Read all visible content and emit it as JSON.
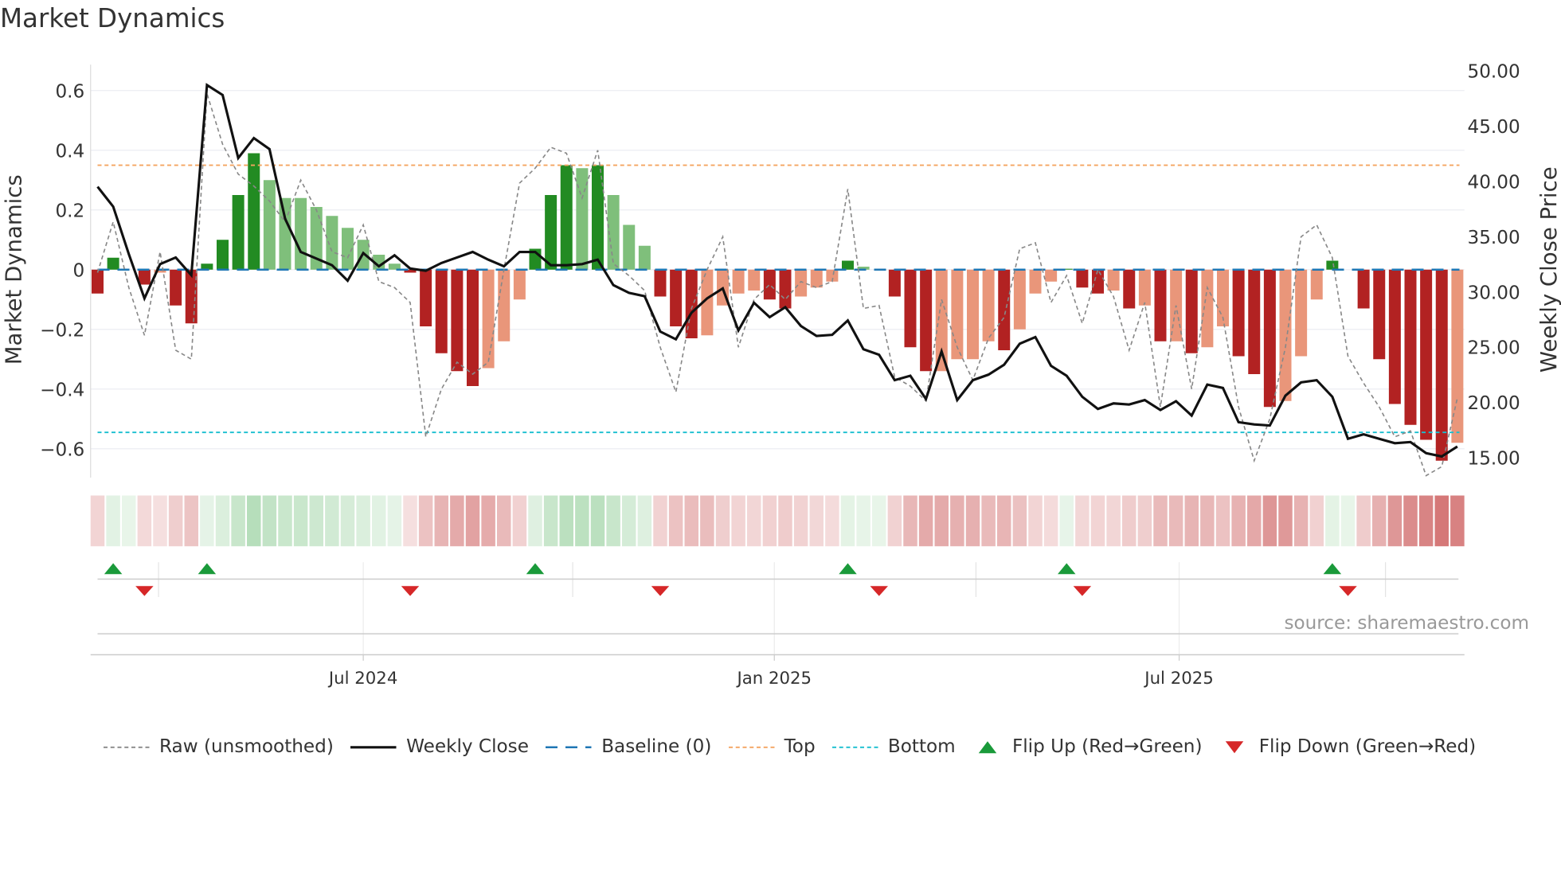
{
  "title": "Market Dynamics",
  "source": "source: sharemaestro.com",
  "colors": {
    "strong_green": "#228b22",
    "weak_green": "#7fbf7b",
    "strong_red": "#b22222",
    "weak_red": "#e9967a",
    "baseline": "#1f77b4",
    "top": "#f4a460",
    "bottom": "#17becf",
    "weekly_close": "#111111",
    "raw": "#888888",
    "flip_up": "#1a9a3a",
    "flip_down": "#d62728"
  },
  "legend": [
    {
      "key": "raw",
      "label": "Raw (unsmoothed)"
    },
    {
      "key": "close",
      "label": "Weekly Close"
    },
    {
      "key": "baseline",
      "label": "Baseline (0)"
    },
    {
      "key": "top",
      "label": "Top"
    },
    {
      "key": "bottom",
      "label": "Bottom"
    },
    {
      "key": "flip_up",
      "label": "Flip Up (Red→Green)"
    },
    {
      "key": "flip_down",
      "label": "Flip Down (Green→Red)"
    }
  ],
  "chart_data": {
    "type": "bar",
    "title": "Market Dynamics",
    "ylabel": "Market Dynamics",
    "y2label": "Weekly Close Price",
    "ylim": [
      -0.69,
      0.69
    ],
    "y2lim": [
      12.8,
      52.2
    ],
    "yticks": [
      "0.6",
      "0.4",
      "0.2",
      "0",
      "−0.2",
      "−0.4",
      "−0.6"
    ],
    "ytick_values": [
      0.6,
      0.4,
      0.2,
      0,
      -0.2,
      -0.4,
      -0.6
    ],
    "y2ticks": [
      "50.00",
      "45.00",
      "40.00",
      "35.00",
      "30.00",
      "25.00",
      "20.00",
      "15.00"
    ],
    "y2tick_values": [
      50,
      45,
      40,
      35,
      30,
      25,
      20,
      15
    ],
    "xticks": [
      {
        "label": "Jul 2024",
        "week": 17
      },
      {
        "label": "Jan 2025",
        "week": 43.3
      },
      {
        "label": "Jul 2025",
        "week": 69.2
      }
    ],
    "minor_xticks_week": [
      3.9,
      30.4,
      56.2,
      82.4
    ],
    "top_level": 0.35,
    "bottom_level": -0.545,
    "baseline": 0,
    "grid": true,
    "legend_position": "bottom",
    "bars": {
      "values": [
        -0.08,
        0.04,
        0,
        -0.05,
        -0.01,
        -0.12,
        -0.18,
        0.02,
        0.1,
        0.25,
        0.39,
        0.3,
        0.24,
        0.24,
        0.21,
        0.18,
        0.14,
        0.1,
        0.05,
        0.02,
        -0.01,
        -0.19,
        -0.28,
        -0.34,
        -0.39,
        -0.33,
        -0.24,
        -0.1,
        0.07,
        0.25,
        0.35,
        0.34,
        0.35,
        0.25,
        0.15,
        0.08,
        -0.09,
        -0.19,
        -0.23,
        -0.22,
        -0.12,
        -0.08,
        -0.07,
        -0.1,
        -0.13,
        -0.09,
        -0.06,
        -0.04,
        0.03,
        0.01,
        0,
        -0.09,
        -0.26,
        -0.34,
        -0.34,
        -0.3,
        -0.3,
        -0.24,
        -0.27,
        -0.2,
        -0.08,
        -0.04,
        0.003,
        -0.06,
        -0.08,
        -0.07,
        -0.13,
        -0.12,
        -0.24,
        -0.24,
        -0.28,
        -0.26,
        -0.19,
        -0.29,
        -0.35,
        -0.46,
        -0.44,
        -0.29,
        -0.1,
        0.03,
        0,
        -0.13,
        -0.3,
        -0.45,
        -0.52,
        -0.57,
        -0.64,
        -0.58
      ],
      "strength": [
        "s",
        "s",
        "w",
        "s",
        "w",
        "s",
        "s",
        "s",
        "s",
        "s",
        "s",
        "w",
        "w",
        "w",
        "w",
        "w",
        "w",
        "w",
        "w",
        "w",
        "s",
        "s",
        "s",
        "s",
        "s",
        "w",
        "w",
        "w",
        "s",
        "s",
        "s",
        "w",
        "s",
        "w",
        "w",
        "w",
        "s",
        "s",
        "s",
        "w",
        "w",
        "w",
        "w",
        "s",
        "s",
        "w",
        "w",
        "w",
        "s",
        "w",
        "w",
        "s",
        "s",
        "s",
        "w",
        "w",
        "w",
        "w",
        "s",
        "w",
        "w",
        "w",
        "s",
        "s",
        "s",
        "w",
        "s",
        "w",
        "s",
        "w",
        "s",
        "w",
        "w",
        "s",
        "s",
        "s",
        "w",
        "w",
        "w",
        "s",
        "w",
        "s",
        "s",
        "s",
        "s",
        "s",
        "s",
        "w"
      ]
    },
    "weekly_close": [
      39.5,
      37.7,
      33.4,
      29.4,
      32.5,
      33.1,
      31.5,
      48.7,
      47.8,
      42.1,
      43.9,
      42.9,
      36.6,
      33.6,
      33.0,
      32.4,
      31.0,
      33.5,
      32.3,
      33.3,
      32.1,
      31.9,
      32.6,
      33.1,
      33.6,
      32.9,
      32.3,
      33.6,
      33.6,
      32.4,
      32.4,
      32.5,
      32.9,
      30.6,
      29.9,
      29.6,
      26.4,
      25.7,
      28.1,
      29.4,
      30.3,
      26.5,
      29.0,
      27.7,
      28.6,
      26.9,
      26.0,
      26.1,
      27.4,
      24.8,
      24.3,
      22.0,
      22.4,
      20.3,
      24.6,
      20.2,
      22.0,
      22.5,
      23.4,
      25.3,
      25.9,
      23.3,
      22.4,
      20.5,
      19.4,
      19.9,
      19.8,
      20.2,
      19.3,
      20.1,
      18.8,
      21.6,
      21.3,
      18.2,
      18.0,
      17.9,
      20.6,
      21.8,
      22.0,
      20.5,
      16.7,
      17.1,
      16.7,
      16.3,
      16.4,
      15.4,
      15.1,
      16.0
    ],
    "raw": [
      -0.01,
      0.16,
      -0.06,
      -0.22,
      0.06,
      -0.27,
      -0.3,
      0.59,
      0.42,
      0.32,
      0.28,
      0.23,
      0.16,
      0.3,
      0.2,
      0.06,
      0.04,
      0.15,
      -0.04,
      -0.06,
      -0.11,
      -0.56,
      -0.4,
      -0.31,
      -0.35,
      -0.31,
      0.0,
      0.29,
      0.34,
      0.41,
      0.39,
      0.24,
      0.4,
      0.02,
      -0.02,
      -0.07,
      -0.26,
      -0.41,
      -0.13,
      0.0,
      0.11,
      -0.26,
      -0.1,
      -0.05,
      -0.1,
      -0.04,
      -0.06,
      -0.04,
      0.27,
      -0.13,
      -0.12,
      -0.36,
      -0.39,
      -0.44,
      -0.1,
      -0.26,
      -0.37,
      -0.23,
      -0.16,
      0.07,
      0.09,
      -0.11,
      -0.02,
      -0.18,
      0.0,
      -0.09,
      -0.27,
      -0.11,
      -0.46,
      -0.12,
      -0.4,
      -0.06,
      -0.16,
      -0.46,
      -0.64,
      -0.5,
      -0.26,
      0.11,
      0.15,
      0.04,
      -0.29,
      -0.38,
      -0.46,
      -0.56,
      -0.54,
      -0.69,
      -0.66,
      -0.43
    ],
    "flip_up_weeks": [
      1,
      7,
      28,
      48,
      62,
      79
    ],
    "flip_down_weeks": [
      3,
      20,
      36,
      50,
      63,
      80
    ]
  }
}
